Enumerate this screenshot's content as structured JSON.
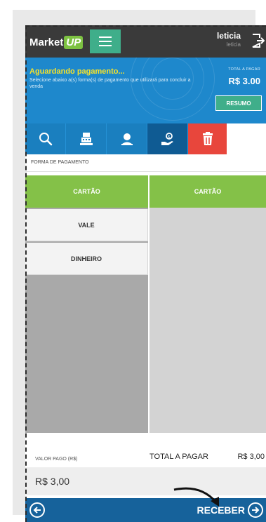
{
  "header": {
    "logo_text": "Market",
    "logo_badge": "UP",
    "user_name": "leticia",
    "user_sub": "leticia"
  },
  "status": {
    "title": "Aguardando pagamento...",
    "description": "Selecione abaixo a(s) forma(s) de pagamento que utilizará para concluir a venda",
    "total_label": "TOTAL A PAGAR",
    "total_value": "R$ 3.00",
    "resumo_label": "RESUMO"
  },
  "toolbar": {
    "items": [
      {
        "icon": "search-icon"
      },
      {
        "icon": "cash-register-icon"
      },
      {
        "icon": "customer-icon"
      },
      {
        "icon": "hand-money-icon",
        "active": true
      },
      {
        "icon": "trash-icon"
      }
    ]
  },
  "payment": {
    "section_label": "FORMA DE PAGAMENTO",
    "options": [
      {
        "label": "CARTÃO",
        "selected": true
      },
      {
        "label": "VALE",
        "selected": false
      },
      {
        "label": "DINHEIRO",
        "selected": false
      }
    ],
    "selected_header": "CARTÃO"
  },
  "summary": {
    "valor_pago_label": "VALOR PAGO (R$)",
    "valor_pago_value": "R$ 3,00",
    "total_label": "TOTAL A PAGAR",
    "total_value": "R$ 3,00"
  },
  "footer": {
    "receber_label": "RECEBER"
  },
  "colors": {
    "header": "#3a3a3a",
    "banner": "#1e88cc",
    "accent_green": "#84c148",
    "teal": "#3fae8a",
    "delete_red": "#e8463c",
    "footer": "#16629b",
    "status_yellow": "#f5e12a"
  }
}
